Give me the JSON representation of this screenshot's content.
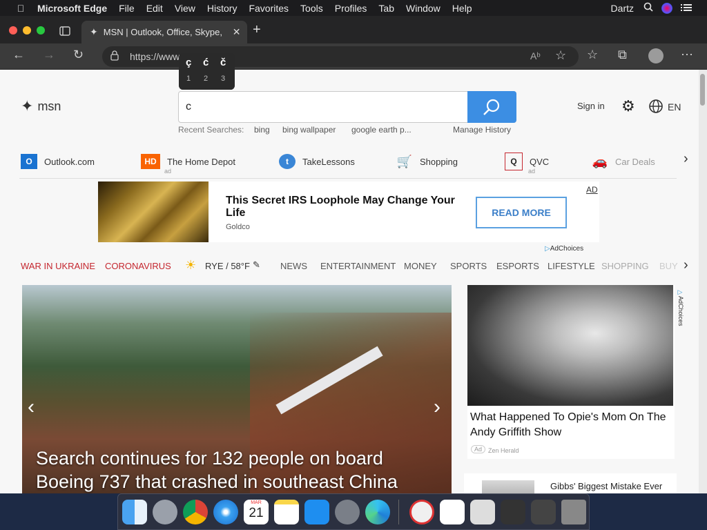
{
  "menubar": {
    "app_name": "Microsoft Edge",
    "items": [
      "File",
      "Edit",
      "View",
      "History",
      "Favorites",
      "Tools",
      "Profiles",
      "Tab",
      "Window",
      "Help"
    ],
    "user": "Dartz"
  },
  "tab": {
    "title": "MSN | Outlook, Office, Skype,"
  },
  "address": {
    "url": "https://www"
  },
  "accent_popup": {
    "chars": [
      "ç",
      "ć",
      "č"
    ],
    "nums": [
      "1",
      "2",
      "3"
    ]
  },
  "msn": {
    "logo_text": "msn",
    "search_value": "c",
    "recent_label": "Recent Searches:",
    "recent": [
      "bing",
      "bing wallpaper",
      "google earth p..."
    ],
    "manage_history": "Manage History",
    "sign_in": "Sign in",
    "lang": "EN"
  },
  "quicklinks": [
    {
      "label": "Outlook.com",
      "ad": ""
    },
    {
      "label": "The Home Depot",
      "ad": "ad"
    },
    {
      "label": "TakeLessons",
      "ad": ""
    },
    {
      "label": "Shopping",
      "ad": ""
    },
    {
      "label": "QVC",
      "ad": "ad"
    },
    {
      "label": "Car Deals",
      "ad": ""
    }
  ],
  "ad_banner": {
    "title": "This Secret IRS Loophole May Change Your Life",
    "source": "Goldco",
    "cta": "READ MORE",
    "ad_tag": "AD",
    "adchoices": "AdChoices"
  },
  "nav": {
    "hot": [
      "WAR IN UKRAINE",
      "CORONAVIRUS"
    ],
    "weather": "RYE / 58°F",
    "items": [
      "NEWS",
      "ENTERTAINMENT",
      "MONEY",
      "SPORTS",
      "ESPORTS",
      "LIFESTYLE",
      "SHOPPING",
      "BUY"
    ]
  },
  "hero": {
    "headline": "Search continues for 132 people on board Boeing 737 that crashed in southeast China"
  },
  "side_card": {
    "title": "What Happened To Opie's Mom On The Andy Griffith Show",
    "ad_badge": "Ad",
    "source": "Zen Herald",
    "adchoices": "AdChoices"
  },
  "side_card2": {
    "title": "Gibbs' Biggest Mistake Ever"
  },
  "dock": {
    "calendar_month": "MAR",
    "calendar_day": "21"
  },
  "colors": {
    "accent": "#3c8ee3",
    "hot_link": "#c4262e"
  }
}
